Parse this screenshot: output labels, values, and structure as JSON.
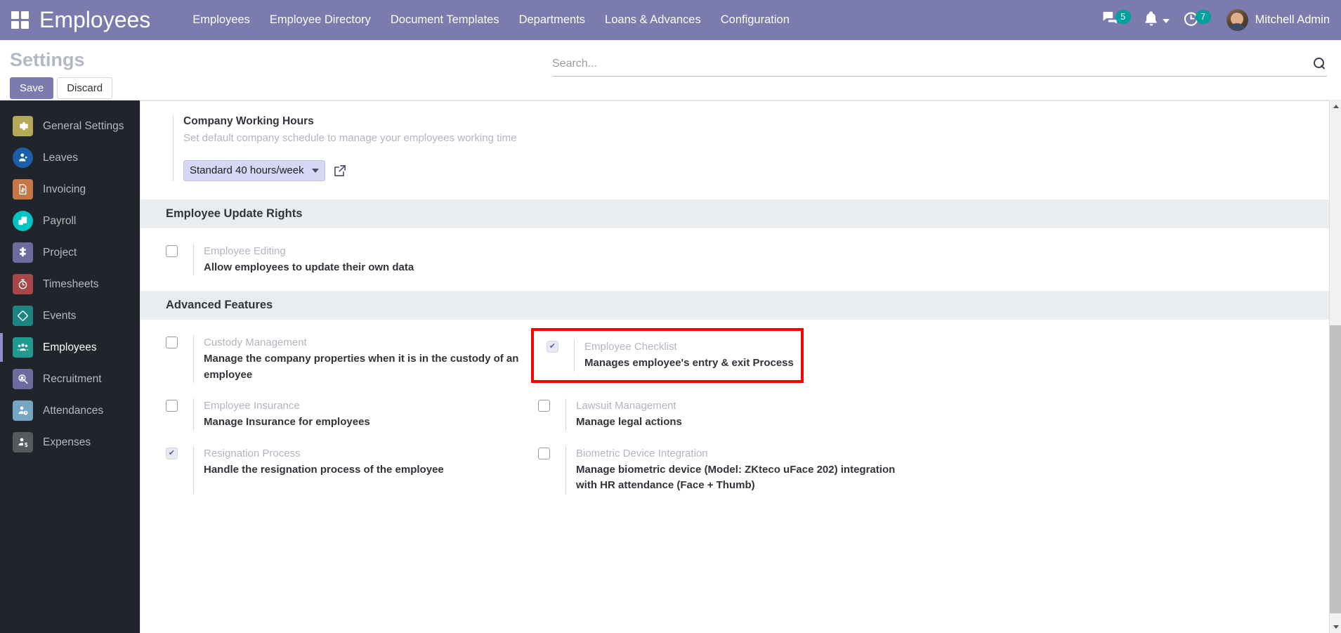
{
  "navbar": {
    "apps_icon": "apps-grid-icon",
    "brand": "Employees",
    "menu": [
      {
        "label": "Employees"
      },
      {
        "label": "Employee Directory"
      },
      {
        "label": "Document Templates"
      },
      {
        "label": "Departments"
      },
      {
        "label": "Loans & Advances"
      },
      {
        "label": "Configuration"
      }
    ],
    "messages": {
      "icon": "comments-icon",
      "count": "5"
    },
    "activities": {
      "icon": "bell-icon"
    },
    "timer": {
      "icon": "clock-icon",
      "count": "7"
    },
    "user": {
      "name": "Mitchell Admin",
      "avatar": "user-avatar"
    }
  },
  "control_panel": {
    "title": "Settings",
    "save_label": "Save",
    "discard_label": "Discard",
    "search_placeholder": "Search...",
    "search_value": "",
    "search_icon": "search-icon"
  },
  "sidebar": {
    "items": [
      {
        "label": "General Settings",
        "icon": "gear-icon",
        "color": "#b5a958",
        "shape": "square",
        "active": false
      },
      {
        "label": "Leaves",
        "icon": "user-leave-icon",
        "color": "#1a5fa8",
        "shape": "circle",
        "active": false
      },
      {
        "label": "Invoicing",
        "icon": "invoice-document-icon",
        "color": "#c77746",
        "shape": "square",
        "active": false
      },
      {
        "label": "Payroll",
        "icon": "payroll-money-icon",
        "color": "#00c4c4",
        "shape": "circle",
        "active": false
      },
      {
        "label": "Project",
        "icon": "puzzle-icon",
        "color": "#6b6b9e",
        "shape": "square",
        "active": false
      },
      {
        "label": "Timesheets",
        "icon": "stopwatch-icon",
        "color": "#a8474a",
        "shape": "square",
        "active": false
      },
      {
        "label": "Events",
        "icon": "ticket-diamond-icon",
        "color": "#1d8383",
        "shape": "square",
        "active": false
      },
      {
        "label": "Employees",
        "icon": "people-group-icon",
        "color": "#1f9a8f",
        "shape": "square",
        "active": true
      },
      {
        "label": "Recruitment",
        "icon": "magnifier-person-icon",
        "color": "#6b6b9e",
        "shape": "square",
        "active": false
      },
      {
        "label": "Attendances",
        "icon": "person-clock-icon",
        "color": "#74a5c2",
        "shape": "square",
        "active": false
      },
      {
        "label": "Expenses",
        "icon": "person-dollar-icon",
        "color": "#555a5f",
        "shape": "square",
        "active": false
      }
    ]
  },
  "main": {
    "working_hours": {
      "title": "Company Working Hours",
      "description": "Set default company schedule to manage your employees working time",
      "select_value": "Standard 40 hours/week",
      "caret_icon": "chevron-down-icon",
      "external_link_icon": "external-link-icon"
    },
    "sections": [
      {
        "header": "Employee Update Rights",
        "rows": [
          [
            {
              "label": "Employee Editing",
              "description": "Allow employees to update their own data",
              "checked": false,
              "highlighted": false
            }
          ]
        ]
      },
      {
        "header": "Advanced Features",
        "rows": [
          [
            {
              "label": "Custody Management",
              "description": "Manage the company properties when it is in the custody of an employee",
              "checked": false,
              "highlighted": false
            },
            {
              "label": "Employee Checklist",
              "description": "Manages employee's entry & exit Process",
              "checked": true,
              "highlighted": true
            }
          ],
          [
            {
              "label": "Employee Insurance",
              "description": "Manage Insurance for employees",
              "checked": false,
              "highlighted": false
            },
            {
              "label": "Lawsuit Management",
              "description": "Manage legal actions",
              "checked": false,
              "highlighted": false
            }
          ],
          [
            {
              "label": "Resignation Process",
              "description": "Handle the resignation process of the employee",
              "checked": true,
              "highlighted": false
            },
            {
              "label": "Biometric Device Integration",
              "description": "Manage biometric device (Model: ZKteco uFace 202) integration with HR attendance (Face + Thumb)",
              "checked": false,
              "highlighted": false
            }
          ]
        ]
      }
    ]
  },
  "colors": {
    "brand_purple": "#7c7bad",
    "badge_teal": "#00a09d",
    "highlight_red": "#ff0000",
    "sidebar_bg": "#21252b"
  }
}
